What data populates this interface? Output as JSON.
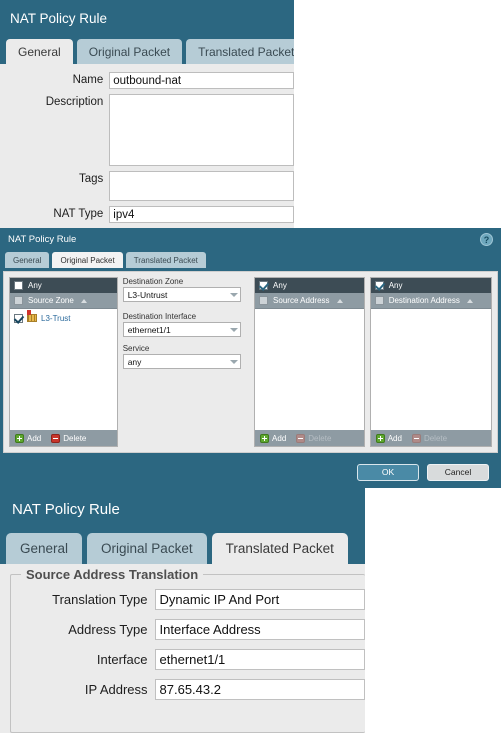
{
  "panel_general": {
    "title": "NAT Policy Rule",
    "tabs": [
      {
        "label": "General",
        "active": true
      },
      {
        "label": "Original Packet",
        "active": false
      },
      {
        "label": "Translated Packet",
        "active": false
      }
    ],
    "fields": [
      {
        "label": "Name",
        "value": "outbound-nat"
      },
      {
        "label": "Description",
        "value": ""
      },
      {
        "label": "Tags",
        "value": ""
      },
      {
        "label": "NAT Type",
        "value": "ipv4"
      }
    ]
  },
  "panel_original": {
    "title": "NAT Policy Rule",
    "help_icon": "help-circle-icon",
    "tabs": [
      {
        "label": "General",
        "active": false
      },
      {
        "label": "Original Packet",
        "active": true
      },
      {
        "label": "Translated Packet",
        "active": false
      }
    ],
    "source_zone_list": {
      "any_label": "Any",
      "any_checked": false,
      "header_label": "Source Zone",
      "header_checked": false,
      "rows": [
        {
          "label": "L3-Trust",
          "checked": true,
          "icon": "zone-icon",
          "flagged": true
        }
      ],
      "add_label": "Add",
      "delete_label": "Delete",
      "delete_disabled": false
    },
    "middle_fields": [
      {
        "label": "Destination Zone",
        "value": "L3-Untrust"
      },
      {
        "label": "Destination Interface",
        "value": "ethernet1/1"
      },
      {
        "label": "Service",
        "value": "any"
      }
    ],
    "source_address_list": {
      "any_label": "Any",
      "any_checked": true,
      "header_label": "Source Address",
      "header_checked": false,
      "rows": [],
      "add_label": "Add",
      "delete_label": "Delete",
      "delete_disabled": true
    },
    "destination_address_list": {
      "any_label": "Any",
      "any_checked": true,
      "header_label": "Destination Address",
      "header_checked": false,
      "rows": [],
      "add_label": "Add",
      "delete_label": "Delete",
      "delete_disabled": true
    },
    "footer": {
      "ok_label": "OK",
      "cancel_label": "Cancel"
    }
  },
  "panel_translated": {
    "title": "NAT Policy Rule",
    "tabs": [
      {
        "label": "General",
        "active": false
      },
      {
        "label": "Original Packet",
        "active": false
      },
      {
        "label": "Translated Packet",
        "active": true
      }
    ],
    "group_title": "Source Address Translation",
    "fields": [
      {
        "label": "Translation Type",
        "value": "Dynamic IP And Port"
      },
      {
        "label": "Address Type",
        "value": "Interface Address"
      },
      {
        "label": "Interface",
        "value": "ethernet1/1"
      },
      {
        "label": "IP Address",
        "value": "87.65.43.2"
      }
    ]
  },
  "colors": {
    "titlebar": "#2c6781",
    "tab_inactive": "#b6ccd6",
    "tab_active": "#ebebeb",
    "list_header_dark": "#3d4c55",
    "list_header_grey": "#8e9ba3",
    "add_green": "#5ea82e",
    "delete_red": "#c8352b",
    "ok_button": "#4a8aa6",
    "link_blue": "#2b6a9c"
  }
}
